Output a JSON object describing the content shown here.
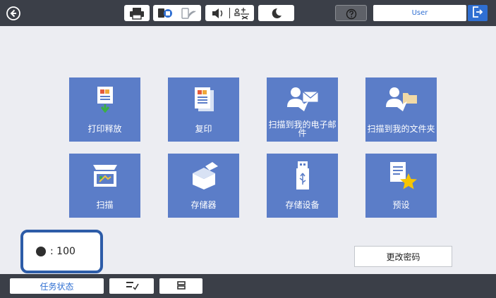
{
  "topbar": {
    "icons": [
      "back-icon",
      "printer-icon",
      "network-icon",
      "wifi-direct-icon",
      "volume-icon",
      "quiet-mode-icon",
      "sleep-icon",
      "help-icon"
    ],
    "user_label": "User",
    "logout_icon": "logout-icon"
  },
  "tiles": [
    {
      "label": "打印释放",
      "icon": "print-release-icon"
    },
    {
      "label": "复印",
      "icon": "copy-icon"
    },
    {
      "label": "扫描到我的电子邮件",
      "icon": "scan-to-email-icon"
    },
    {
      "label": "扫描到我的文件夹",
      "icon": "scan-to-folder-icon"
    },
    {
      "label": "扫描",
      "icon": "scan-icon"
    },
    {
      "label": "存储器",
      "icon": "storage-icon"
    },
    {
      "label": "存储设备",
      "icon": "memory-device-icon"
    },
    {
      "label": "预设",
      "icon": "presets-icon"
    }
  ],
  "counter": {
    "value": ": 100",
    "color": "#2f2f2f"
  },
  "change_password_label": "更改密码",
  "bottombar": {
    "status_label": "任务状态",
    "icons": [
      "job-list-icon",
      "stop-icon"
    ]
  },
  "colors": {
    "topbar": "#3b3f48",
    "tile": "#5b7dc8",
    "accent": "#2f6fd2",
    "highlight": "#2d5ca8"
  }
}
